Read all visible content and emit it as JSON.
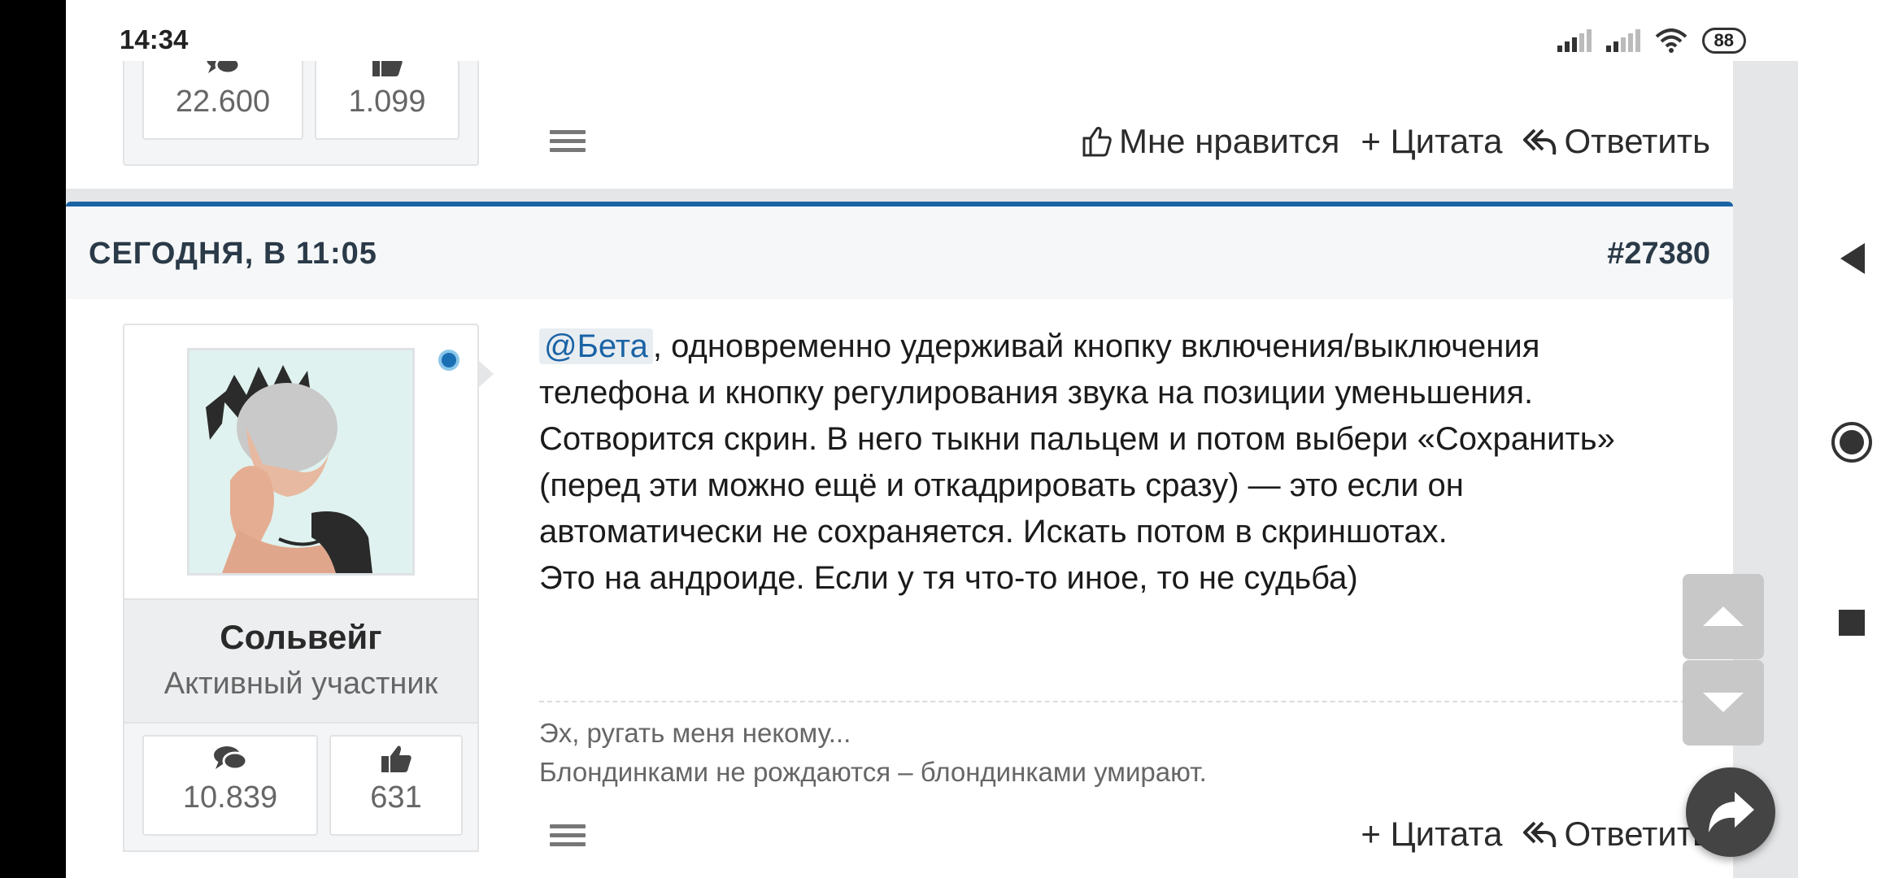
{
  "status_bar": {
    "time": "14:34",
    "battery": "88",
    "icons": [
      "signal-icon",
      "signal-icon",
      "wifi-icon",
      "battery-icon"
    ]
  },
  "previous_post": {
    "stats": {
      "messages": "22.600",
      "likes": "1.099"
    },
    "actions": {
      "like": "Мне нравится",
      "quote": "+ Цитата",
      "reply": "Ответить"
    }
  },
  "post": {
    "date": "СЕГОДНЯ, В 11:05",
    "number": "#27380",
    "user": {
      "name": "Сольвейг",
      "title": "Активный участник",
      "stats": {
        "messages": "10.839",
        "likes": "631"
      }
    },
    "mention": "@Бета",
    "lines": [
      ", одновременно удерживай кнопку включения/выключения",
      "телефона и кнопку регулирования звука на позиции уменьшения.",
      "Сотворится скрин. В него тыкни пальцем и потом выбери «Сохранить»",
      "(перед эти можно ещё и откадрировать сразу) — это если он",
      "автоматически не сохраняется. Искать потом в скриншотах.",
      "Это на андроиде. Если у тя что-то иное, то не судьба)"
    ],
    "signature": [
      "Эх, ругать меня некому...",
      "Блондинками не рождаются – блондинками умирают."
    ],
    "actions": {
      "quote": "+ Цитата",
      "reply": "Ответить"
    }
  },
  "colors": {
    "accent": "#1a63a5",
    "online": "#1a6fb3",
    "text": "#1b1b1b",
    "muted": "#666666"
  }
}
